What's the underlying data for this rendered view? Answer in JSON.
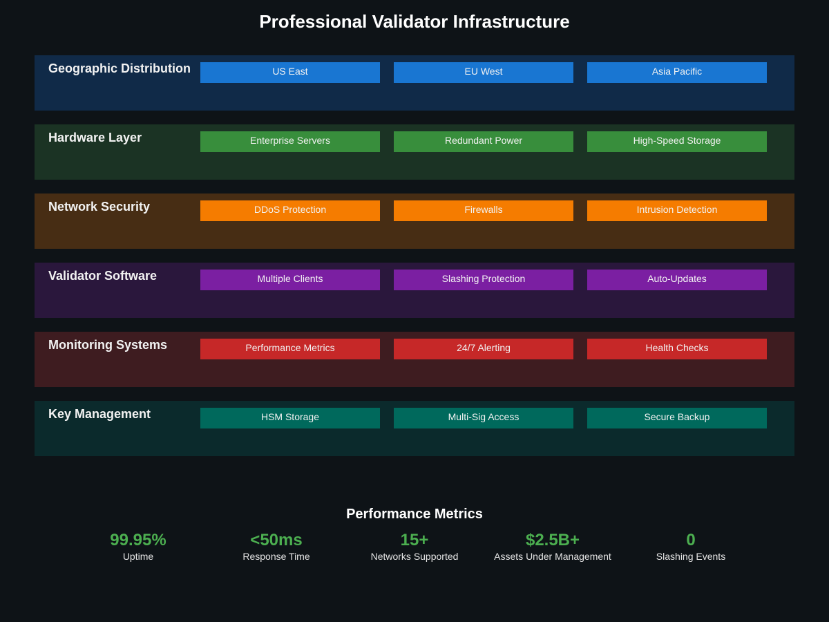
{
  "title": "Professional Validator Infrastructure",
  "layers": [
    {
      "label": "Geographic Distribution",
      "band_color": "#102a48",
      "component_color": "#1976d2",
      "components": [
        "US East",
        "EU West",
        "Asia Pacific"
      ]
    },
    {
      "label": "Hardware Layer",
      "band_color": "#1b3324",
      "component_color": "#388e3c",
      "components": [
        "Enterprise Servers",
        "Redundant Power",
        "High-Speed Storage"
      ]
    },
    {
      "label": "Network Security",
      "band_color": "#472d14",
      "component_color": "#f57c00",
      "components": [
        "DDoS Protection",
        "Firewalls",
        "Intrusion Detection"
      ]
    },
    {
      "label": "Validator Software",
      "band_color": "#2a173c",
      "component_color": "#7b1fa2",
      "components": [
        "Multiple Clients",
        "Slashing Protection",
        "Auto-Updates"
      ]
    },
    {
      "label": "Monitoring Systems",
      "band_color": "#3e1c20",
      "component_color": "#c62828",
      "components": [
        "Performance Metrics",
        "24/7 Alerting",
        "Health Checks"
      ]
    },
    {
      "label": "Key Management",
      "band_color": "#0b2a2c",
      "component_color": "#00695c",
      "components": [
        "HSM Storage",
        "Multi-Sig Access",
        "Secure Backup"
      ]
    }
  ],
  "metrics_title": "Performance Metrics",
  "metric_color": "#4caf50",
  "metrics": [
    {
      "value": "99.95%",
      "label": "Uptime"
    },
    {
      "value": "<50ms",
      "label": "Response Time"
    },
    {
      "value": "15+",
      "label": "Networks Supported"
    },
    {
      "value": "$2.5B+",
      "label": "Assets Under Management"
    },
    {
      "value": "0",
      "label": "Slashing Events"
    }
  ]
}
